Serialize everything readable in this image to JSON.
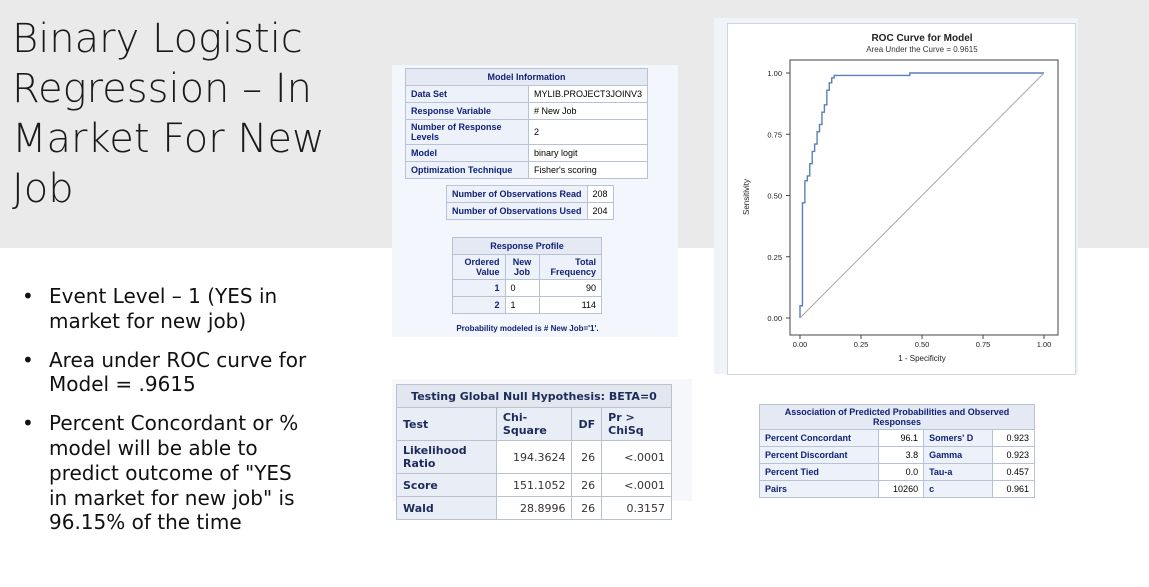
{
  "slide": {
    "title": "Binary Logistic Regression – In Market For New Job",
    "bullets": [
      "Event Level – 1 (YES in market for new job)",
      "Area under ROC curve for Model = .9615",
      "Percent Concordant or % model will be able to predict outcome of \"YES in market for new job\" is 96.15% of the time"
    ]
  },
  "model_info": {
    "caption": "Model Information",
    "rows": [
      [
        "Data Set",
        "MYLIB.PROJECT3JOINV3"
      ],
      [
        "Response Variable",
        "# New Job"
      ],
      [
        "Number of Response Levels",
        "2"
      ],
      [
        "Model",
        "binary logit"
      ],
      [
        "Optimization Technique",
        "Fisher's scoring"
      ]
    ]
  },
  "observations": {
    "rows": [
      [
        "Number of Observations Read",
        "208"
      ],
      [
        "Number of Observations Used",
        "204"
      ]
    ]
  },
  "response_profile": {
    "caption": "Response Profile",
    "headers": [
      "Ordered Value",
      "New Job",
      "Total Frequency"
    ],
    "rows": [
      [
        "1",
        "0",
        "90"
      ],
      [
        "2",
        "1",
        "114"
      ]
    ],
    "note": "Probability modeled is # New Job='1'."
  },
  "global_null": {
    "caption": "Testing Global Null Hypothesis: BETA=0",
    "headers": [
      "Test",
      "Chi-Square",
      "DF",
      "Pr > ChiSq"
    ],
    "rows": [
      [
        "Likelihood Ratio",
        "194.3624",
        "26",
        "<.0001"
      ],
      [
        "Score",
        "151.1052",
        "26",
        "<.0001"
      ],
      [
        "Wald",
        "28.8996",
        "26",
        "0.3157"
      ]
    ]
  },
  "association": {
    "caption": "Association of Predicted Probabilities and Observed Responses",
    "rows": [
      [
        "Percent Concordant",
        "96.1",
        "Somers' D",
        "0.923"
      ],
      [
        "Percent Discordant",
        "3.8",
        "Gamma",
        "0.923"
      ],
      [
        "Percent Tied",
        "0.0",
        "Tau-a",
        "0.457"
      ],
      [
        "Pairs",
        "10260",
        "c",
        "0.961"
      ]
    ]
  },
  "chart_data": {
    "type": "line",
    "title": "ROC Curve for Model",
    "subtitle": "Area Under the Curve = 0.9615",
    "xlabel": "1 - Specificity",
    "ylabel": "Sensitivity",
    "xlim": [
      0,
      1
    ],
    "ylim": [
      0,
      1
    ],
    "xticks": [
      "0.00",
      "0.25",
      "0.50",
      "0.75",
      "1.00"
    ],
    "yticks": [
      "0.00",
      "0.25",
      "0.50",
      "0.75",
      "1.00"
    ],
    "series": [
      {
        "color": "#5b7fb8",
        "x": [
          0,
          0,
          0.01,
          0.01,
          0.02,
          0.02,
          0.03,
          0.03,
          0.04,
          0.04,
          0.05,
          0.05,
          0.06,
          0.06,
          0.07,
          0.07,
          0.08,
          0.08,
          0.09,
          0.09,
          0.1,
          0.1,
          0.11,
          0.11,
          0.12,
          0.12,
          0.13,
          0.13,
          0.14,
          0.14,
          0.45,
          0.45,
          1.0
        ],
        "y": [
          0,
          0.05,
          0.05,
          0.47,
          0.47,
          0.56,
          0.56,
          0.58,
          0.58,
          0.63,
          0.63,
          0.68,
          0.68,
          0.71,
          0.71,
          0.76,
          0.76,
          0.79,
          0.79,
          0.84,
          0.84,
          0.87,
          0.87,
          0.93,
          0.93,
          0.96,
          0.96,
          0.98,
          0.98,
          0.99,
          0.99,
          1.0,
          1.0
        ]
      },
      {
        "color": "#a9a9a9",
        "x": [
          0,
          1
        ],
        "y": [
          0,
          1
        ]
      }
    ]
  }
}
